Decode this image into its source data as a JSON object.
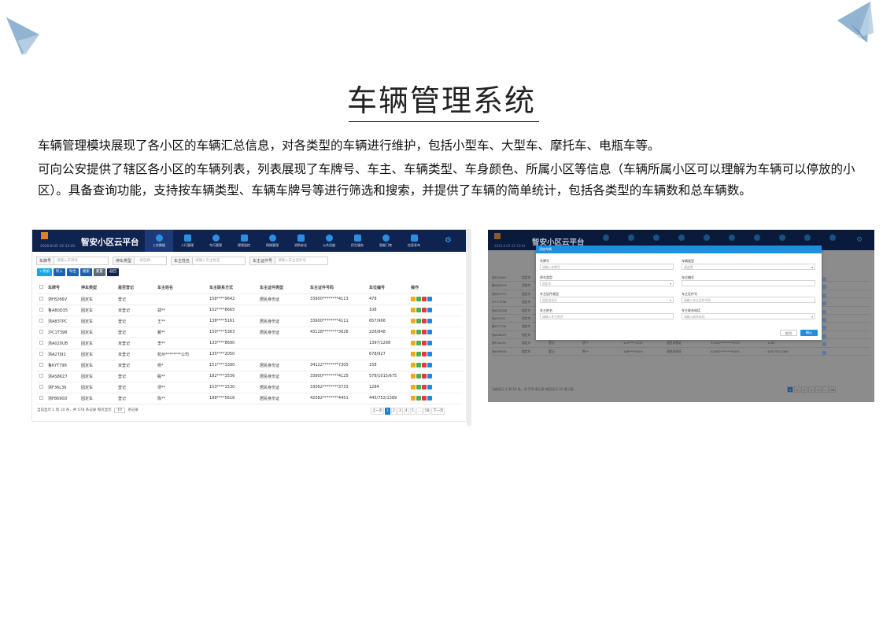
{
  "page": {
    "title": "车辆管理系统",
    "intro": [
      "车辆管理模块展现了各小区的车辆汇总信息，对各类型的车辆进行维护，包括小型车、大型车、摩托车、电瓶车等。",
      "可向公安提供了辖区各小区的车辆列表，列表展现了车牌号、车主、车辆类型、车身颜色、所属小区等信息（车辆所属小区可以理解为车辆可以停放的小区）。具备查询功能，支持按车辆类型、车辆车牌号等进行筛选和搜索，并提供了车辆的简单统计，包括各类型的车辆数和总车辆数。"
    ]
  },
  "app": {
    "brand": "智安小区云平台",
    "date": "2020.8.05  22:13:01",
    "nav": [
      "三实数据",
      "人行管理",
      "车行管理",
      "视频监控",
      "网格管理",
      "消防安全",
      "公共设施",
      "民生服务",
      "智能门禁",
      "信息发布"
    ],
    "active_nav": 0
  },
  "filters": [
    {
      "label": "车牌号",
      "placeholder": "请输入车牌号"
    },
    {
      "label": "停车类型",
      "placeholder": "--请选择--"
    },
    {
      "label": "车主姓名",
      "placeholder": "请输入车主姓名"
    },
    {
      "label": "车主证件号",
      "placeholder": "请输入车主证件号"
    }
  ],
  "toolbar": [
    {
      "label": "+添加",
      "color": "#1aa3e8"
    },
    {
      "label": "导入",
      "color": "#1d5fb0"
    },
    {
      "label": "导出",
      "color": "#1d5fb0"
    },
    {
      "label": "搜索",
      "color": "#1d5fb0"
    },
    {
      "label": "重置",
      "color": "#5d6b7c"
    },
    {
      "label": "返回",
      "color": "#0f2350"
    }
  ],
  "table": {
    "columns": [
      "车牌号",
      "停车类型",
      "是否登记",
      "车主姓名",
      "车主联系方式",
      "车主证件类型",
      "车主证件号码",
      "车位编号",
      "操作"
    ],
    "rows": [
      [
        "浙F8266V",
        "固定车",
        "登记",
        "",
        "158****9642",
        "居民身份证",
        "33900********4113",
        "478"
      ],
      [
        "鲁A80D35",
        "固定车",
        "未登记",
        "郑**",
        "152****8665",
        "",
        "",
        "108"
      ],
      [
        "浙A837PC",
        "固定车",
        "登记",
        "王**",
        "138****5161",
        "居民身份证",
        "33900********4111",
        "657/966"
      ],
      [
        "沪C1T398",
        "固定车",
        "登记",
        "戴**",
        "150****5363",
        "居民身份证",
        "43128********3628",
        "226/848"
      ],
      [
        "浙A020UB",
        "固定车",
        "未登记",
        "李**",
        "133****8690",
        "",
        "",
        "1397/1298"
      ],
      [
        "浙A27J92",
        "固定车",
        "未登记",
        "杭州********公司",
        "135****2050",
        "",
        "",
        "678/927"
      ],
      [
        "鲁KYT798",
        "固定车",
        "未登记",
        "杨*",
        "151****3390",
        "居民身份证",
        "34122********7305",
        "158"
      ],
      [
        "浙AS8KZ7",
        "固定车",
        "登记",
        "殷**",
        "182****3536",
        "居民身份证",
        "33900********4125",
        "578/1015/675"
      ],
      [
        "浙F36L36",
        "固定车",
        "登记",
        "项**",
        "153****1530",
        "居民身份证",
        "33062********3733",
        "1284"
      ],
      [
        "浙F8690D",
        "固定车",
        "登记",
        "陈**",
        "188****5616",
        "居民身份证",
        "42082********4451",
        "445/752/1389"
      ]
    ],
    "op_colors": [
      "#f5a623",
      "#4caf50",
      "#e53935",
      "#1e88e5"
    ]
  },
  "footer": {
    "summary": "当前显示 1 到 10 条，共 578 条记录  每页显示",
    "page_size": "10",
    "suffix": "条记录"
  },
  "pager": [
    "上一页",
    "1",
    "2",
    "3",
    "4",
    "5",
    "...",
    "58",
    "下一页"
  ],
  "modal": {
    "title": "添加车辆",
    "fields": [
      {
        "label": "车牌号",
        "placeholder": "请输入车牌号"
      },
      {
        "label": "车辆类型",
        "placeholder": "请选择"
      },
      {
        "label": "停车类型",
        "placeholder": "固定车"
      },
      {
        "label": "车位编号",
        "placeholder": ""
      },
      {
        "label": "车主证件类型",
        "placeholder": "居民身份证"
      },
      {
        "label": "车主证件号",
        "placeholder": "请输入车主证件号码"
      },
      {
        "label": "车主姓名",
        "placeholder": "请输入车主姓名"
      },
      {
        "label": "车主联系电话",
        "placeholder": "请输入联系电话"
      }
    ],
    "cancel": "取消",
    "confirm": "确认"
  }
}
